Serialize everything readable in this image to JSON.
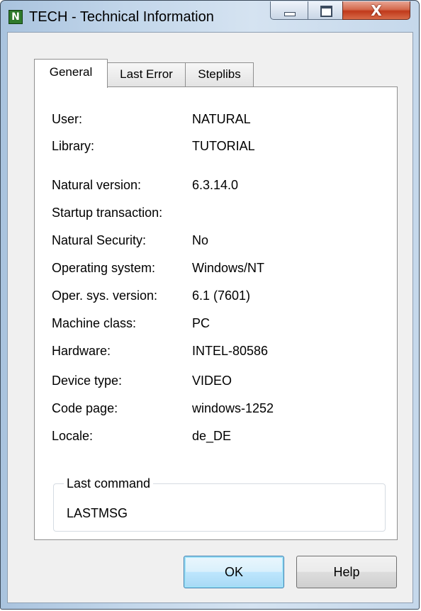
{
  "window": {
    "title": "TECH - Technical Information",
    "app_icon_letter": "N",
    "close_glyph": "X"
  },
  "tabs": [
    {
      "label": "General",
      "active": true
    },
    {
      "label": "Last Error",
      "active": false
    },
    {
      "label": "Steplibs",
      "active": false
    }
  ],
  "info": {
    "user": {
      "label": "User:",
      "value": "NATURAL"
    },
    "library": {
      "label": "Library:",
      "value": "TUTORIAL"
    },
    "natural_version": {
      "label": "Natural version:",
      "value": "6.3.14.0"
    },
    "startup_transaction": {
      "label": "Startup transaction:",
      "value": ""
    },
    "natural_security": {
      "label": "Natural Security:",
      "value": "No"
    },
    "operating_system": {
      "label": "Operating system:",
      "value": "Windows/NT"
    },
    "os_version": {
      "label": "Oper. sys. version:",
      "value": "6.1 (7601)"
    },
    "machine_class": {
      "label": "Machine class:",
      "value": "PC"
    },
    "hardware": {
      "label": "Hardware:",
      "value": "INTEL-80586"
    },
    "device_type": {
      "label": "Device type:",
      "value": "VIDEO"
    },
    "code_page": {
      "label": "Code page:",
      "value": "windows-1252"
    },
    "locale": {
      "label": "Locale:",
      "value": "de_DE"
    }
  },
  "last_command": {
    "title": "Last command",
    "value": "LASTMSG"
  },
  "buttons": {
    "ok": "OK",
    "help": "Help"
  }
}
